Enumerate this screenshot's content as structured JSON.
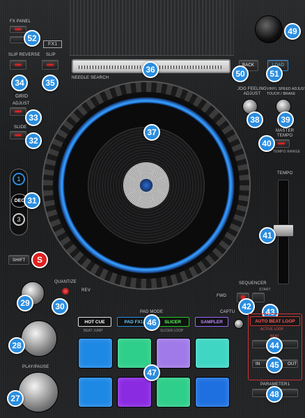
{
  "labels": {
    "fx_panel": "FX PANEL",
    "fx1": "FX1",
    "slip_reverse": "SLIP REVERSE",
    "slip": "SLIP",
    "grid": "GRID",
    "adjust": "ADJUST",
    "slide": "SLIDE",
    "needle_search": "NEEDLE SEARCH",
    "back": "BACK",
    "load": "LOAD",
    "jog_feeling_adjust": "JOG FEELING\nADJUST",
    "vinyl_speed_adjust": "VINYL SPEED ADJUST\nTOUCH / BRAKE",
    "master_tempo": "MASTER\nTEMPO",
    "tempo_range": "TEMPO RANGE",
    "tempo": "TEMPO",
    "dec": "DEC",
    "shift": "SHIFT",
    "quantize": "QUANTIZE",
    "sequencer": "SEQUENCER",
    "start": "START",
    "rev": "REV",
    "fwd": "FWD",
    "pad_mode": "PAD MODE",
    "hot_cue": "HOT CUE",
    "pad_fx1": "PAD FX1",
    "slicer": "SLICER",
    "sampler": "SAMPLER",
    "beat_jump": "BEAT JUMP",
    "slicer_loop": "SLICER LOOP",
    "auto_beat_loop": "AUTO BEAT LOOP",
    "active_loop": "ACTIVE LOOP",
    "beat": "BEAT",
    "in": "IN",
    "out": "OUT",
    "parameter1": "PARAMETER1",
    "play_pause": "PLAY/PAUSE",
    "capture": "CAPTU"
  },
  "badges": [
    "52",
    "34",
    "35",
    "33",
    "32",
    "36",
    "49",
    "50",
    "51",
    "38",
    "39",
    "40",
    "37",
    "31",
    "41",
    "29",
    "30",
    "42",
    "43",
    "28",
    "46",
    "44",
    "45",
    "47",
    "27",
    "48"
  ],
  "deck_numbers": [
    "1",
    "3"
  ],
  "shift_badge": "S",
  "colors": {
    "badge_blue": "#2a8de0",
    "jog_ring_blue": "#3aa3ff",
    "red_led": "#dd2222",
    "pad_colors": [
      "#1e88e5",
      "#2ecf8a",
      "#a07ae8",
      "#3fd6c4",
      "#1e88e5",
      "#8a2be2",
      "#2ecf8a",
      "#1e70e0"
    ]
  }
}
